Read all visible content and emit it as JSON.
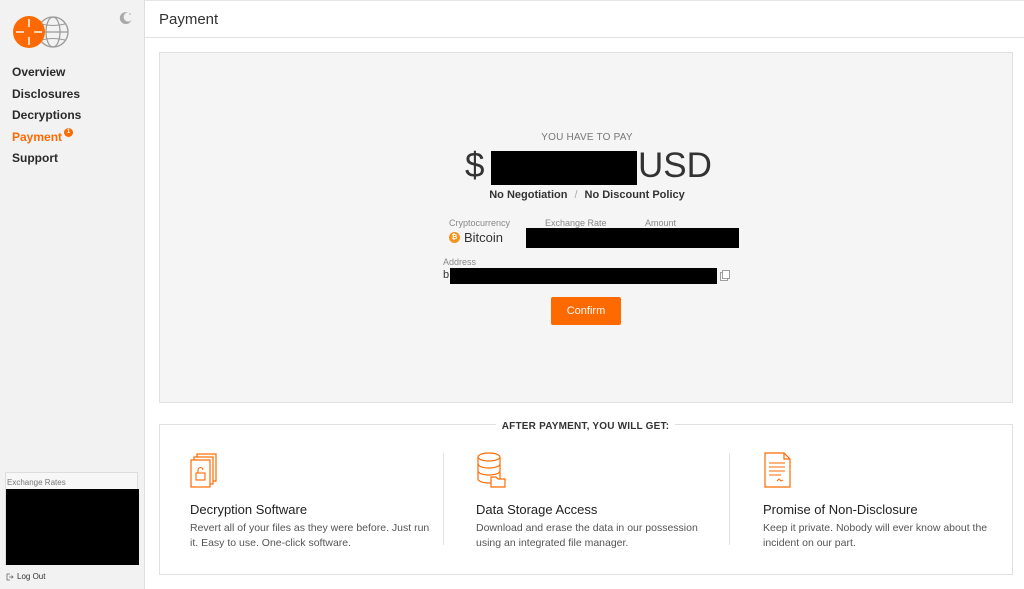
{
  "sidebar": {
    "items": [
      {
        "label": "Overview"
      },
      {
        "label": "Disclosures"
      },
      {
        "label": "Decryptions"
      },
      {
        "label": "Payment",
        "badge": "1"
      },
      {
        "label": "Support"
      }
    ],
    "exchange_rates_label": "Exchange Rates",
    "logout_label": "Log Out"
  },
  "header": {
    "title": "Payment"
  },
  "payment": {
    "heading": "YOU HAVE TO PAY",
    "currency_symbol": "$",
    "currency_code": "USD",
    "term_1": "No Negotiation",
    "term_2": "No Discount Policy",
    "labels": {
      "cryptocurrency": "Cryptocurrency",
      "exchange_rate": "Exchange Rate",
      "amount": "Amount",
      "address": "Address"
    },
    "cryptocurrency_value": "Bitcoin",
    "address_prefix": "b",
    "confirm_label": "Confirm"
  },
  "after_payment": {
    "title": "AFTER PAYMENT, YOU WILL GET:",
    "features": [
      {
        "title": "Decryption Software",
        "text": "Revert all of your files as they were before. Just run it. Easy to use. One-click software."
      },
      {
        "title": "Data Storage Access",
        "text": "Download and erase the data in our possession using an integrated file manager."
      },
      {
        "title": "Promise of Non-Disclosure",
        "text": "Keep it private. Nobody will ever know about the incident on our part."
      }
    ]
  },
  "colors": {
    "accent": "#ff6a00",
    "bitcoin": "#f7931a"
  }
}
